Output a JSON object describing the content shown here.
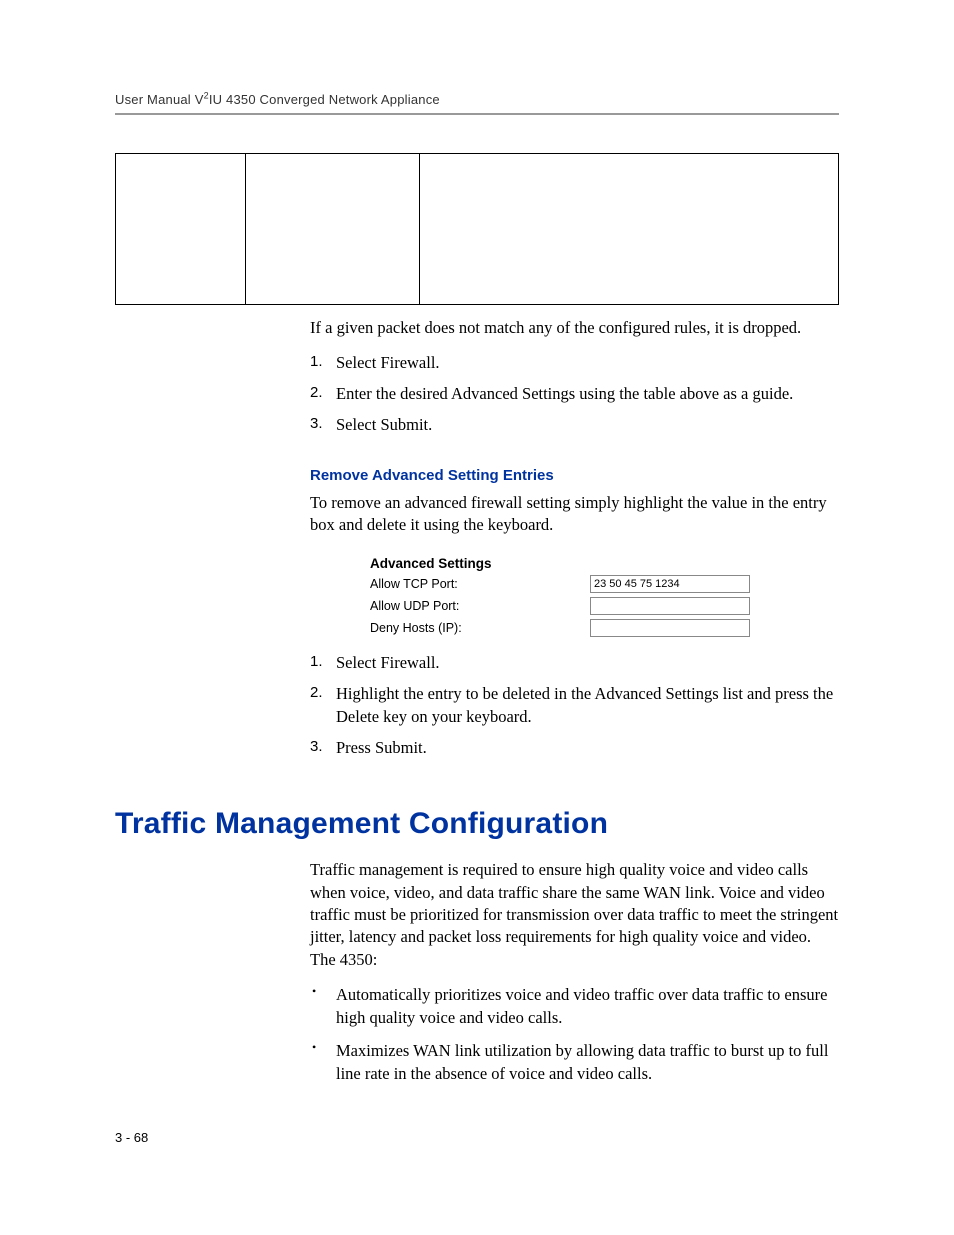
{
  "header": {
    "prefix": "User Manual V",
    "sup": "2",
    "suffix": "IU 4350 Converged Network Appliance"
  },
  "intro_para": "If a given packet does not match any of the configured rules, it is dropped.",
  "steps1": [
    "Select Firewall.",
    "Enter the desired Advanced Settings using the table above as a guide.",
    "Select Submit."
  ],
  "sub_heading": "Remove Advanced Setting Entries",
  "remove_para": "To remove an advanced firewall setting simply highlight the value in the entry box and delete it using the keyboard.",
  "advanced": {
    "title": "Advanced Settings",
    "rows": [
      {
        "label": "Allow TCP Port:",
        "value": "23 50 45 75 1234"
      },
      {
        "label": "Allow UDP Port:",
        "value": ""
      },
      {
        "label": "Deny Hosts (IP):",
        "value": ""
      }
    ]
  },
  "steps2": [
    "Select Firewall.",
    "Highlight the entry to be deleted in the Advanced Settings list and press the Delete key on your keyboard.",
    "Press Submit."
  ],
  "main_heading": "Traffic Management Configuration",
  "traffic_para": "Traffic management is required to ensure high quality voice and video calls when voice, video, and data traffic share the same WAN link. Voice and video traffic must be prioritized for transmission over data traffic to meet the stringent jitter, latency and packet loss requirements for high quality voice and video. The 4350:",
  "bullets": [
    "Automatically prioritizes voice and video traffic over data traffic to ensure high quality voice and video calls.",
    "Maximizes WAN link utilization by allowing data traffic to burst up to full line rate in the absence of voice and video calls."
  ],
  "footer": "3 - 68"
}
